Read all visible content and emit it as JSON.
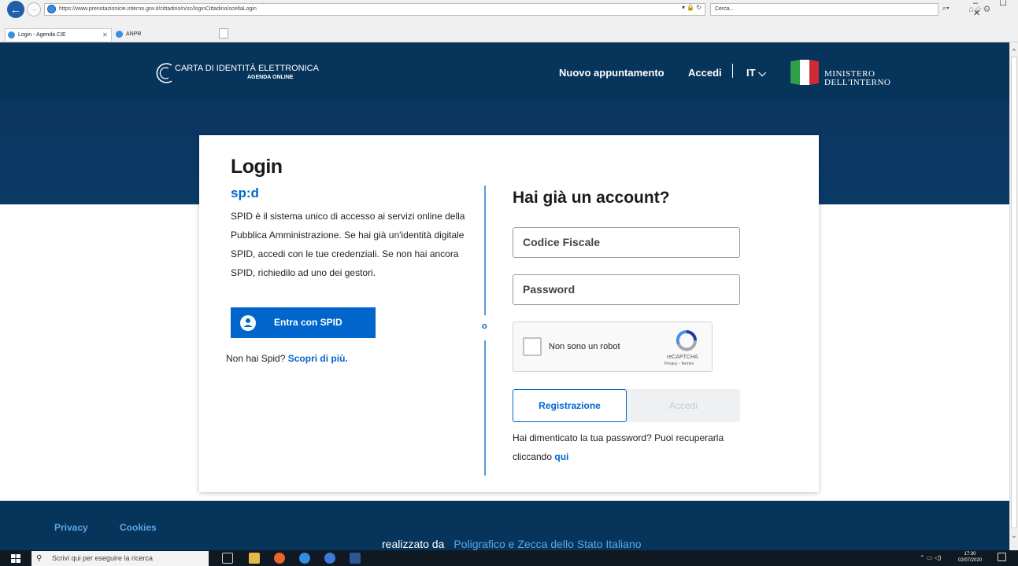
{
  "browser": {
    "url": "https://www.prenotazionicie.interno.gov.it/cittadino/n/sc/loginCittadino/sceltaLogin",
    "search_placeholder": "Cerca...",
    "tabs": [
      {
        "label": "Login - Agenda CIE"
      },
      {
        "label": "ANPR"
      }
    ],
    "window_controls": "–  ☐  ✕"
  },
  "header": {
    "brand_title": "CARTA DI IDENTITÀ ELETTRONICA",
    "brand_subtitle": "AGENDA ONLINE",
    "nav_nuovo": "Nuovo appuntamento",
    "nav_accedi": "Accedi",
    "nav_lang": "IT",
    "ministero_line1": "MINISTERO",
    "ministero_line2": "DELL'INTERNO"
  },
  "login": {
    "title": "Login",
    "spid_logo": "sp:d",
    "spid_description": "SPID è il sistema unico di accesso ai servizi online della Pubblica Amministrazione. Se hai già un'identità digitale SPID, accedi con le tue credenziali. Se non hai ancora SPID, richiedilo ad uno dei gestori.",
    "spid_button": "Entra con SPID",
    "no_spid_text": "Non hai Spid?",
    "no_spid_link": "Scopri di più.",
    "divider_label": "o",
    "account_title": "Hai già un account?",
    "codice_fiscale_placeholder": "Codice Fiscale",
    "password_placeholder": "Password",
    "recaptcha_label": "Non sono un robot",
    "recaptcha_brand": "reCAPTCHA",
    "recaptcha_links": "Privacy - Termini",
    "registrazione_button": "Registrazione",
    "accedi_button": "Accedi",
    "forgot_text": "Hai dimenticato la tua password? Puoi recuperarla cliccando",
    "forgot_link": "qui"
  },
  "footer": {
    "privacy": "Privacy",
    "cookies": "Cookies",
    "made_by": "realizzato da",
    "made_by_link": "Poligrafico e Zecca dello Stato Italiano"
  },
  "taskbar": {
    "search_placeholder": "Scrivi qui per eseguire la ricerca",
    "time": "17:30",
    "date": "02/07/2020"
  },
  "colors": {
    "header_bg": "#07345b",
    "accent": "#0066cc",
    "link_footer": "#5aa7e6"
  }
}
